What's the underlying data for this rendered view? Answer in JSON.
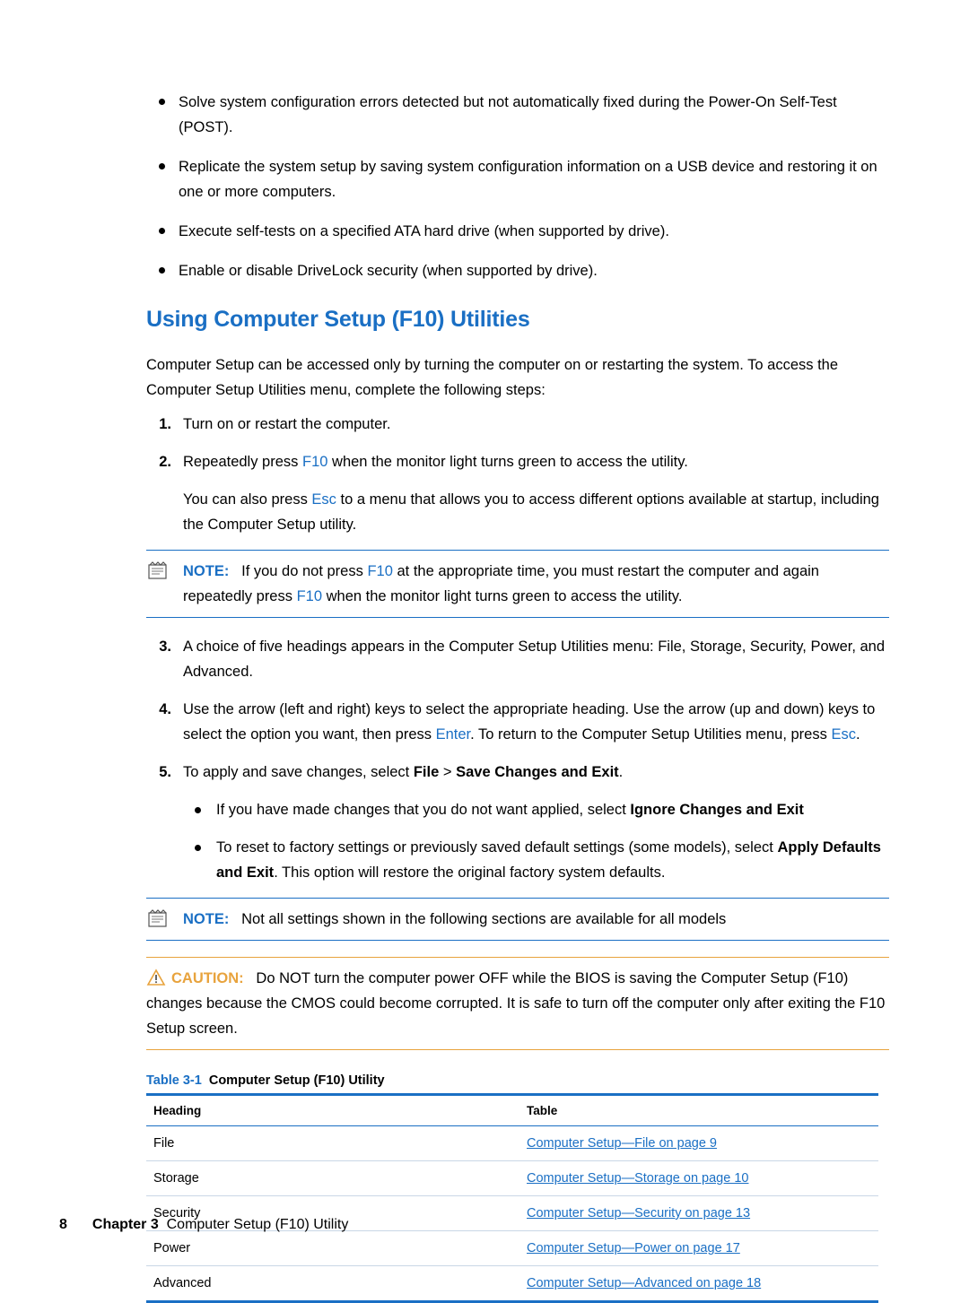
{
  "top_bullets": [
    "Solve system configuration errors detected but not automatically fixed during the Power-On Self-Test (POST).",
    "Replicate the system setup by saving system configuration information on a USB device and restoring it on one or more computers.",
    "Execute self-tests on a specified ATA hard drive (when supported by drive).",
    "Enable or disable DriveLock security (when supported by drive)."
  ],
  "heading": "Using Computer Setup (F10) Utilities",
  "intro": "Computer Setup can be accessed only by turning the computer on or restarting the system. To access the Computer Setup Utilities menu, complete the following steps:",
  "steps": {
    "s1_num": "1.",
    "s1_text": "Turn on or restart the computer.",
    "s2_num": "2.",
    "s2_a": "Repeatedly press ",
    "s2_key": "F10",
    "s2_b": " when the monitor light turns green to access the utility.",
    "s2_sub_a": "You can also press ",
    "s2_sub_key": "Esc",
    "s2_sub_b": " to a menu that allows you to access different options available at startup, including the Computer Setup utility.",
    "s3_num": "3.",
    "s3_text": "A choice of five headings appears in the Computer Setup Utilities menu: File, Storage, Security, Power, and Advanced.",
    "s4_num": "4.",
    "s4_a": "Use the arrow (left and right) keys to select the appropriate heading. Use the arrow (up and down) keys to select the option you want, then press ",
    "s4_key1": "Enter",
    "s4_b": ". To return to the Computer Setup Utilities menu, press ",
    "s4_key2": "Esc",
    "s4_c": ".",
    "s5_num": "5.",
    "s5_a": "To apply and save changes, select ",
    "s5_bold1": "File",
    "s5_b": " > ",
    "s5_bold2": "Save Changes and Exit",
    "s5_c": ".",
    "s5_bullet1_a": "If you have made changes that you do not want applied, select ",
    "s5_bullet1_bold": "Ignore Changes and Exit",
    "s5_bullet1_b": "",
    "s5_bullet2_a": "To reset to factory settings or previously saved default settings (some models), select ",
    "s5_bullet2_bold": "Apply Defaults and Exit",
    "s5_bullet2_b": ". This option will restore the original factory system defaults."
  },
  "note1": {
    "label": "NOTE:",
    "icon": "note-icon",
    "text_a": "If you do not press ",
    "key1": "F10",
    "text_b": " at the appropriate time, you must restart the computer and again repeatedly press ",
    "key2": "F10",
    "text_c": " when the monitor light turns green to access the utility."
  },
  "note2": {
    "label": "NOTE:",
    "icon": "note-icon",
    "text": "Not all settings shown in the following sections are available for all models"
  },
  "caution": {
    "label": "CAUTION:",
    "icon": "warning-icon",
    "text": "Do NOT turn the computer power OFF while the BIOS is saving the Computer Setup (F10) changes because the CMOS could become corrupted. It is safe to turn off the computer only after exiting the F10 Setup screen."
  },
  "table": {
    "caption_no": "Table 3-1",
    "caption_title": "Computer Setup (F10) Utility",
    "headers": [
      "Heading",
      "Table"
    ],
    "rows": [
      {
        "heading": "File",
        "link": "Computer Setup—File on page 9"
      },
      {
        "heading": "Storage",
        "link": "Computer Setup—Storage on page 10"
      },
      {
        "heading": "Security",
        "link": "Computer Setup—Security on page 13"
      },
      {
        "heading": "Power",
        "link": "Computer Setup—Power on page 17"
      },
      {
        "heading": "Advanced",
        "link": "Computer Setup—Advanced on page 18"
      }
    ]
  },
  "footer": {
    "page_number": "8",
    "chapter_word": "Chapter",
    "chapter_number": "3",
    "chapter_title": "Computer Setup (F10) Utility"
  },
  "colors": {
    "accent_blue": "#1a6fc4",
    "caution_orange": "#e8a33d",
    "rule_light": "#c9d7e6"
  }
}
